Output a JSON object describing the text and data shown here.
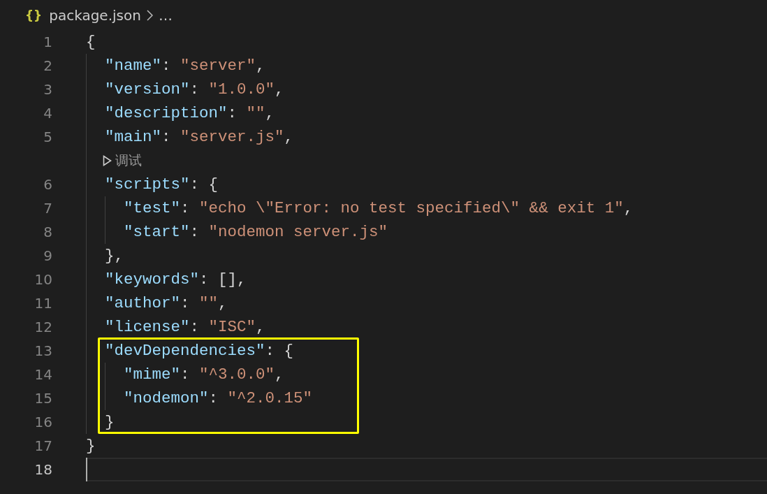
{
  "breadcrumb": {
    "icon": "{}",
    "file": "package.json",
    "more": "…"
  },
  "lines": [
    {
      "kind": "code",
      "number": "1",
      "tokens": [
        {
          "kind": "punct",
          "text": "{"
        }
      ]
    },
    {
      "kind": "code",
      "number": "2",
      "tokens": [
        {
          "kind": "key",
          "text": "  \"name\""
        },
        {
          "kind": "punct",
          "text": ": "
        },
        {
          "kind": "string",
          "text": "\"server\""
        },
        {
          "kind": "punct",
          "text": ","
        }
      ]
    },
    {
      "kind": "code",
      "number": "3",
      "tokens": [
        {
          "kind": "key",
          "text": "  \"version\""
        },
        {
          "kind": "punct",
          "text": ": "
        },
        {
          "kind": "string",
          "text": "\"1.0.0\""
        },
        {
          "kind": "punct",
          "text": ","
        }
      ]
    },
    {
      "kind": "code",
      "number": "4",
      "tokens": [
        {
          "kind": "key",
          "text": "  \"description\""
        },
        {
          "kind": "punct",
          "text": ": "
        },
        {
          "kind": "string",
          "text": "\"\""
        },
        {
          "kind": "punct",
          "text": ","
        }
      ]
    },
    {
      "kind": "code",
      "number": "5",
      "tokens": [
        {
          "kind": "key",
          "text": "  \"main\""
        },
        {
          "kind": "punct",
          "text": ": "
        },
        {
          "kind": "string",
          "text": "\"server.js\""
        },
        {
          "kind": "punct",
          "text": ","
        }
      ]
    },
    {
      "kind": "codelens",
      "label": "调试"
    },
    {
      "kind": "code",
      "number": "6",
      "tokens": [
        {
          "kind": "key",
          "text": "  \"scripts\""
        },
        {
          "kind": "punct",
          "text": ": {"
        }
      ]
    },
    {
      "kind": "code",
      "number": "7",
      "tokens": [
        {
          "kind": "key",
          "text": "    \"test\""
        },
        {
          "kind": "punct",
          "text": ": "
        },
        {
          "kind": "string",
          "text": "\"echo \\\"Error: no test specified\\\" && exit 1\""
        },
        {
          "kind": "punct",
          "text": ","
        }
      ]
    },
    {
      "kind": "code",
      "number": "8",
      "tokens": [
        {
          "kind": "key",
          "text": "    \"start\""
        },
        {
          "kind": "punct",
          "text": ": "
        },
        {
          "kind": "string",
          "text": "\"nodemon server.js\""
        }
      ]
    },
    {
      "kind": "code",
      "number": "9",
      "tokens": [
        {
          "kind": "punct",
          "text": "  },"
        }
      ]
    },
    {
      "kind": "code",
      "number": "10",
      "tokens": [
        {
          "kind": "key",
          "text": "  \"keywords\""
        },
        {
          "kind": "punct",
          "text": ": [],"
        }
      ]
    },
    {
      "kind": "code",
      "number": "11",
      "tokens": [
        {
          "kind": "key",
          "text": "  \"author\""
        },
        {
          "kind": "punct",
          "text": ": "
        },
        {
          "kind": "string",
          "text": "\"\""
        },
        {
          "kind": "punct",
          "text": ","
        }
      ]
    },
    {
      "kind": "code",
      "number": "12",
      "tokens": [
        {
          "kind": "key",
          "text": "  \"license\""
        },
        {
          "kind": "punct",
          "text": ": "
        },
        {
          "kind": "string",
          "text": "\"ISC\""
        },
        {
          "kind": "punct",
          "text": ","
        }
      ]
    },
    {
      "kind": "code",
      "number": "13",
      "highlighted": true,
      "tokens": [
        {
          "kind": "key",
          "text": "  \"devDependencies\""
        },
        {
          "kind": "punct",
          "text": ": {"
        }
      ]
    },
    {
      "kind": "code",
      "number": "14",
      "highlighted": true,
      "tokens": [
        {
          "kind": "key",
          "text": "    \"mime\""
        },
        {
          "kind": "punct",
          "text": ": "
        },
        {
          "kind": "string",
          "text": "\"^3.0.0\""
        },
        {
          "kind": "punct",
          "text": ","
        }
      ]
    },
    {
      "kind": "code",
      "number": "15",
      "highlighted": true,
      "tokens": [
        {
          "kind": "key",
          "text": "    \"nodemon\""
        },
        {
          "kind": "punct",
          "text": ": "
        },
        {
          "kind": "string",
          "text": "\"^2.0.15\""
        }
      ]
    },
    {
      "kind": "code",
      "number": "16",
      "highlighted": true,
      "tokens": [
        {
          "kind": "punct",
          "text": "  }"
        }
      ]
    },
    {
      "kind": "code",
      "number": "17",
      "tokens": [
        {
          "kind": "punct",
          "text": "}"
        }
      ]
    },
    {
      "kind": "code",
      "number": "18",
      "current": true
    }
  ]
}
